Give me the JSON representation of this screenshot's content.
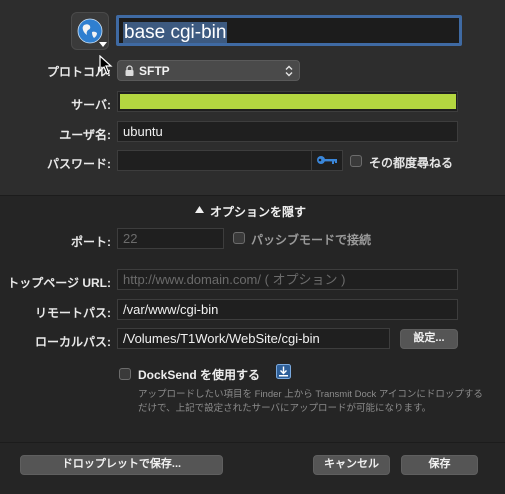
{
  "connection": {
    "name_value": "base cgi-bin",
    "protocol_label": "プロトコル:",
    "protocol_value": "SFTP",
    "server_label": "サーバ:",
    "username_label": "ユーザ名:",
    "username_value": "ubuntu",
    "password_label": "パスワード:",
    "ask_every_time_label": "その都度尋ねる"
  },
  "options": {
    "toggle_label": "オプションを隠す",
    "port_label": "ポート:",
    "port_placeholder": "22",
    "passive_label": "パッシブモードで接続",
    "top_url_label": "トップページ URL:",
    "top_url_placeholder": "http://www.domain.com/ ( オプション )",
    "remote_path_label": "リモートパス:",
    "remote_path_value": "/var/www/cgi-bin",
    "local_path_label": "ローカルパス:",
    "local_path_value": "/Volumes/T1Work/WebSite/cgi-bin",
    "local_path_button": "設定...",
    "docksend_label": "DockSend を使用する",
    "docksend_description": "アップロードしたい項目を Finder 上から Transmit Dock アイコンにドロップするだけで、上記で設定されたサーバにアップロードが可能になります。"
  },
  "footer": {
    "droplet_button": "ドロップレットで保存...",
    "cancel_button": "キャンセル",
    "save_button": "保存"
  },
  "colors": {
    "server_redaction": "#b4d640",
    "focus_ring": "#3f6aa3",
    "key_icon": "#3a86d9"
  }
}
